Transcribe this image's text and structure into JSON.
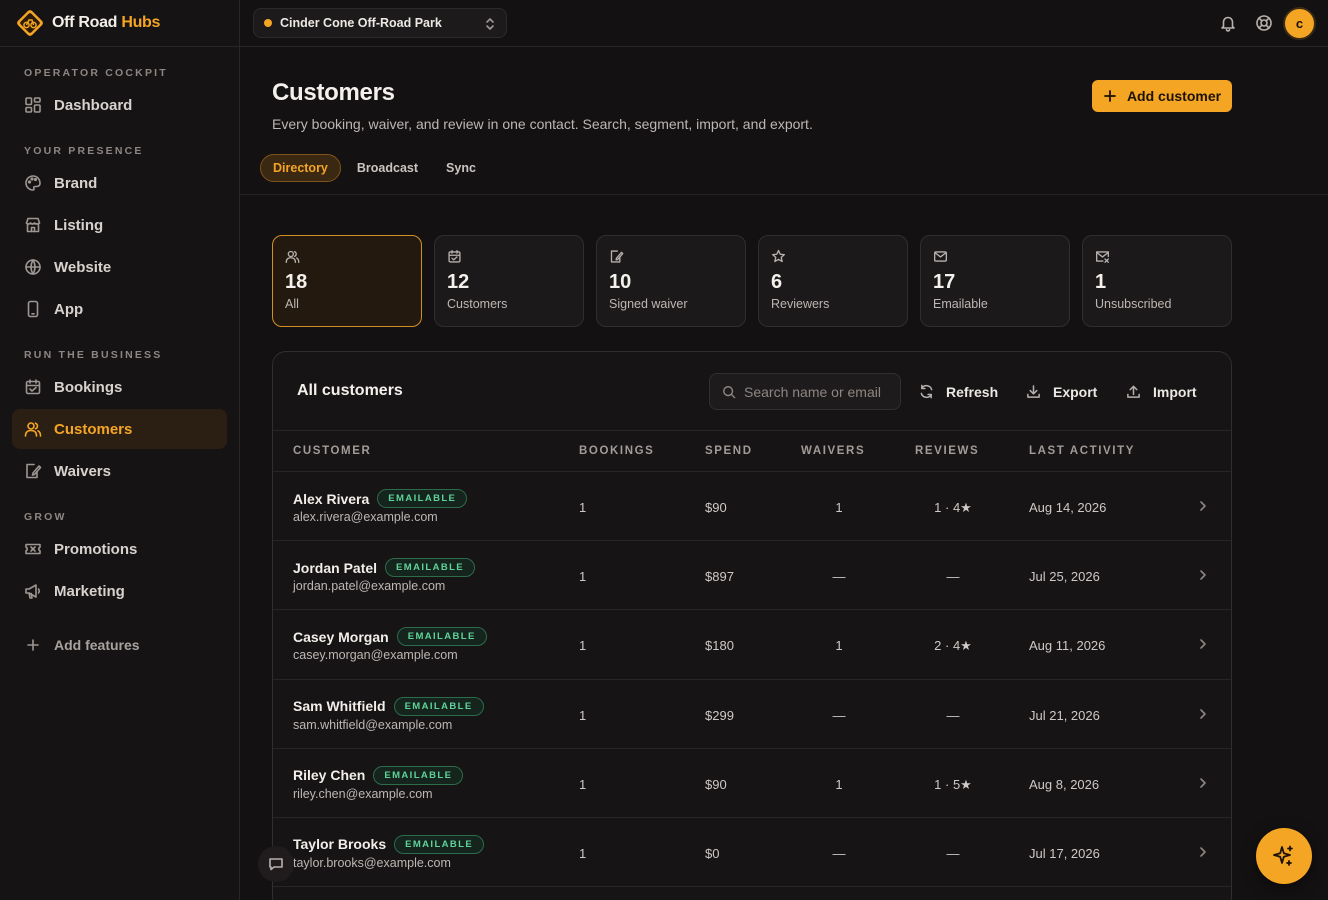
{
  "brand": {
    "name_part1": "Off Road",
    "name_part2": "Hubs"
  },
  "sidebar": {
    "sections": [
      {
        "label": "OPERATOR COCKPIT",
        "items": [
          {
            "label": "Dashboard",
            "icon": "dashboard-icon"
          }
        ]
      },
      {
        "label": "YOUR PRESENCE",
        "items": [
          {
            "label": "Brand",
            "icon": "palette-icon"
          },
          {
            "label": "Listing",
            "icon": "store-icon"
          },
          {
            "label": "Website",
            "icon": "globe-icon"
          },
          {
            "label": "App",
            "icon": "phone-icon"
          }
        ]
      },
      {
        "label": "RUN THE BUSINESS",
        "items": [
          {
            "label": "Bookings",
            "icon": "calendar-icon"
          },
          {
            "label": "Customers",
            "icon": "users-icon",
            "active": true
          },
          {
            "label": "Waivers",
            "icon": "waiver-icon"
          }
        ]
      },
      {
        "label": "GROW",
        "items": [
          {
            "label": "Promotions",
            "icon": "ticket-icon"
          },
          {
            "label": "Marketing",
            "icon": "megaphone-icon"
          }
        ]
      }
    ],
    "add_features": "Add features"
  },
  "topbar": {
    "park_name": "Cinder Cone Off-Road Park",
    "avatar_initial": "c"
  },
  "header": {
    "title": "Customers",
    "subtitle": "Every booking, waiver, and review in one contact. Search, segment, import, and export.",
    "add_button": "Add customer",
    "tabs": [
      {
        "label": "Directory",
        "active": true
      },
      {
        "label": "Broadcast"
      },
      {
        "label": "Sync"
      }
    ]
  },
  "stats": [
    {
      "value": "18",
      "label": "All",
      "icon": "users-icon",
      "active": true
    },
    {
      "value": "12",
      "label": "Customers",
      "icon": "calendar-check-icon"
    },
    {
      "value": "10",
      "label": "Signed waiver",
      "icon": "waiver-icon"
    },
    {
      "value": "6",
      "label": "Reviewers",
      "icon": "star-icon"
    },
    {
      "value": "17",
      "label": "Emailable",
      "icon": "mail-icon"
    },
    {
      "value": "1",
      "label": "Unsubscribed",
      "icon": "mail-x-icon"
    }
  ],
  "table": {
    "title": "All customers",
    "search_placeholder": "Search name or email",
    "refresh": "Refresh",
    "export": "Export",
    "import": "Import",
    "columns": [
      "CUSTOMER",
      "BOOKINGS",
      "SPEND",
      "WAIVERS",
      "REVIEWS",
      "LAST ACTIVITY"
    ],
    "rows": [
      {
        "name": "Alex Rivera",
        "badge": "EMAILABLE",
        "email": "alex.rivera@example.com",
        "bookings": "1",
        "spend": "$90",
        "waivers": "1",
        "reviews": "1 · 4★",
        "last": "Aug 14, 2026"
      },
      {
        "name": "Jordan Patel",
        "badge": "EMAILABLE",
        "email": "jordan.patel@example.com",
        "bookings": "1",
        "spend": "$897",
        "waivers": "—",
        "reviews": "—",
        "last": "Jul 25, 2026"
      },
      {
        "name": "Casey Morgan",
        "badge": "EMAILABLE",
        "email": "casey.morgan@example.com",
        "bookings": "1",
        "spend": "$180",
        "waivers": "1",
        "reviews": "2 · 4★",
        "last": "Aug 11, 2026"
      },
      {
        "name": "Sam Whitfield",
        "badge": "EMAILABLE",
        "email": "sam.whitfield@example.com",
        "bookings": "1",
        "spend": "$299",
        "waivers": "—",
        "reviews": "—",
        "last": "Jul 21, 2026"
      },
      {
        "name": "Riley Chen",
        "badge": "EMAILABLE",
        "email": "riley.chen@example.com",
        "bookings": "1",
        "spend": "$90",
        "waivers": "1",
        "reviews": "1 · 5★",
        "last": "Aug 8, 2026"
      },
      {
        "name": "Taylor Brooks",
        "badge": "EMAILABLE",
        "email": "taylor.brooks@example.com",
        "bookings": "1",
        "spend": "$0",
        "waivers": "—",
        "reviews": "—",
        "last": "Jul 17, 2026"
      }
    ]
  },
  "colors": {
    "accent": "#f5a524",
    "emailable_badge": "#5fd39a",
    "background": "#141113"
  }
}
